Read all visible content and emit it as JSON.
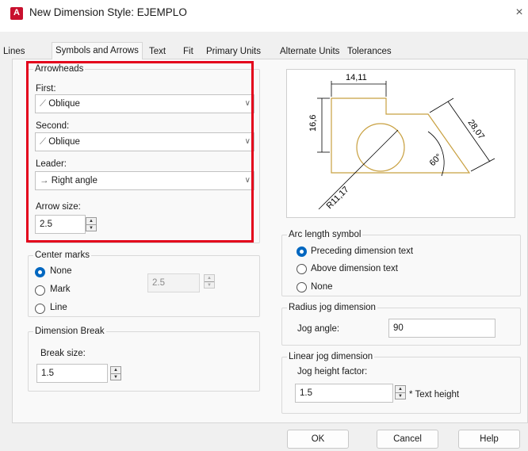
{
  "window": {
    "title": "New Dimension Style: EJEMPLO",
    "close_glyph": "×",
    "app_icon_letter": "A"
  },
  "tabs": [
    {
      "label": "Lines",
      "active": false
    },
    {
      "label": "Symbols and Arrows",
      "active": true
    },
    {
      "label": "Text",
      "active": false
    },
    {
      "label": "Fit",
      "active": false
    },
    {
      "label": "Primary Units",
      "active": false
    },
    {
      "label": "Alternate Units",
      "active": false
    },
    {
      "label": "Tolerances",
      "active": false
    }
  ],
  "arrowheads": {
    "title": "Arrowheads",
    "first_label": "First:",
    "first_value": "Oblique",
    "second_label": "Second:",
    "second_value": "Oblique",
    "leader_label": "Leader:",
    "leader_value": "Right angle",
    "arrow_size_label": "Arrow size:",
    "arrow_size_value": "2.5"
  },
  "center_marks": {
    "title": "Center marks",
    "options": [
      "None",
      "Mark",
      "Line"
    ],
    "selected": "None",
    "size_value": "2.5"
  },
  "dimension_break": {
    "title": "Dimension Break",
    "break_size_label": "Break size:",
    "break_size_value": "1.5"
  },
  "preview": {
    "dim_top": "14,11",
    "dim_left": "16,6",
    "dim_diag": "28,07",
    "dim_angle": "60°",
    "dim_radius": "R11,17",
    "line_color": "#c8a040"
  },
  "arc_length": {
    "title": "Arc length symbol",
    "options": [
      "Preceding dimension text",
      "Above dimension text",
      "None"
    ],
    "selected": "Preceding dimension text"
  },
  "radius_jog": {
    "title": "Radius jog dimension",
    "jog_angle_label": "Jog angle:",
    "jog_angle_value": "90"
  },
  "linear_jog": {
    "title": "Linear jog dimension",
    "factor_label": "Jog height factor:",
    "factor_value": "1.5",
    "suffix": "* Text height"
  },
  "buttons": {
    "ok": "OK",
    "cancel": "Cancel",
    "help": "Help"
  },
  "highlight_color": "#e3001b"
}
